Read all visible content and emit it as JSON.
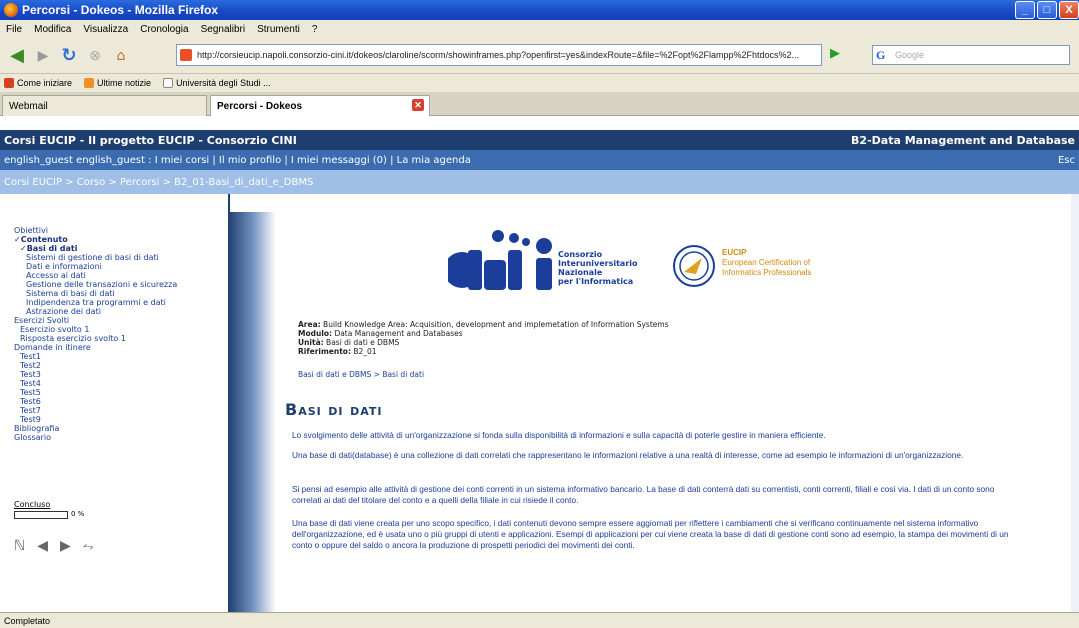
{
  "window": {
    "title": "Percorsi - Dokeos - Mozilla Firefox",
    "buttons": [
      "_",
      "□",
      "X"
    ]
  },
  "menu": [
    "File",
    "Modifica",
    "Visualizza",
    "Cronologia",
    "Segnalibri",
    "Strumenti",
    "?"
  ],
  "nav": {
    "url": "http://corsieucip.napoli.consorzio-cini.it/dokeos/claroline/scorm/showinframes.php?openfirst=yes&indexRoute=&file=%2Fopt%2Flampp%2Fhtdocs%2...",
    "search_placeholder": "Google"
  },
  "bookmarks": [
    "Come iniziare",
    "Ultime notizie",
    "Università degli Studi ..."
  ],
  "tabs": [
    {
      "label": "Webmail",
      "active": false
    },
    {
      "label": "Percorsi - Dokeos",
      "active": true
    }
  ],
  "header": {
    "site_title": "Corsi EUCIP - Il progetto EUCIP - Consorzio CINI",
    "course_title": "B2-Data Management and Database",
    "user_line": "english_guest english_guest : I miei corsi | Il mio profilo | I miei messaggi (0) | La mia agenda",
    "logout": "Esc",
    "breadcrumb": "Corsi EUCIP > Corso > Percorsi > B2_01-Basi_di_dati_e_DBMS"
  },
  "toc": [
    {
      "label": "Obiettivi",
      "level": 0,
      "bold": false
    },
    {
      "label": "✓Contenuto",
      "level": 0,
      "bold": true
    },
    {
      "label": "✓Basi di dati",
      "level": 1,
      "bold": true
    },
    {
      "label": "Sistemi di gestione di basi di dati",
      "level": 2,
      "bold": false
    },
    {
      "label": "Dati e informazioni",
      "level": 2,
      "bold": false
    },
    {
      "label": "Accesso ai dati",
      "level": 2,
      "bold": false
    },
    {
      "label": "Gestione delle transazioni e sicurezza",
      "level": 2,
      "bold": false
    },
    {
      "label": "Sistema di basi di dati",
      "level": 2,
      "bold": false
    },
    {
      "label": "Indipendenza tra programmi e dati",
      "level": 2,
      "bold": false
    },
    {
      "label": "Astrazione dei dati",
      "level": 2,
      "bold": false
    },
    {
      "label": "Esercizi Svolti",
      "level": 0,
      "bold": false
    },
    {
      "label": "Esercizio svolto 1",
      "level": 1,
      "bold": false
    },
    {
      "label": "Risposta esercizio svolto 1",
      "level": 1,
      "bold": false
    },
    {
      "label": "Domande in itinere",
      "level": 0,
      "bold": false
    },
    {
      "label": "Test1",
      "level": 1,
      "bold": false
    },
    {
      "label": "Test2",
      "level": 1,
      "bold": false
    },
    {
      "label": "Test3",
      "level": 1,
      "bold": false
    },
    {
      "label": "Test4",
      "level": 1,
      "bold": false
    },
    {
      "label": "Test5",
      "level": 1,
      "bold": false
    },
    {
      "label": "Test6",
      "level": 1,
      "bold": false
    },
    {
      "label": "Test7",
      "level": 1,
      "bold": false
    },
    {
      "label": "Test9",
      "level": 1,
      "bold": false
    },
    {
      "label": "Bibliografia",
      "level": 0,
      "bold": false
    },
    {
      "label": "Glossario",
      "level": 0,
      "bold": false
    }
  ],
  "progress": {
    "label": "Concluso",
    "value_text": "0 %",
    "value": 0
  },
  "logos": {
    "cini_lines": [
      "Consorzio",
      "Interuniversitario",
      "Nazionale",
      "per l'Informatica"
    ],
    "eucip_lines": [
      "EUCIP",
      "European Certification of",
      "Informatics Professionals"
    ]
  },
  "meta": {
    "area_label": "Area:",
    "area_value": "Build Knowledge Area: Acquisition, development and implemetation of Information Systems",
    "modulo_label": "Modulo:",
    "modulo_value": "Data Management and Databases",
    "unita_label": "Unità:",
    "unita_value": "Basi di dati e DBMS",
    "rif_label": "Riferimento:",
    "rif_value": "B2_01"
  },
  "content_breadcrumb": "Basi di dati e DBMS > Basi di dati",
  "page_title": "Basi di dati",
  "paragraphs": [
    "Lo svolgimento delle attività di un'organizzazione si fonda sulla disponibilità di informazioni e sulla capacità di poterle gestire in maniera efficiente.",
    "Una base di dati(database) è una collezione di dati correlati che rappresentano le informazioni relative a una realtà di interesse, come ad esempio le informazioni di un'organizzazione.",
    "Si pensi ad esempio alle attività di gestione dei conti correnti in un sistema informativo bancario. La base di dati conterrà dati su correntisti, conti correnti, filiali e così via. I dati di un conto sono correlati ai dati del titolare del conto e a quelli della filiale in cui risiede il conto.",
    "Una base di dati viene creata per uno scopo specifico, i dati contenuti devono sempre essere aggiornati per riflettere i cambiamenti che si verificano continuamente nel sistema informativo dell'organizzazione, ed è usata uno o più gruppi di utenti e applicazioni. Esempi di applicazioni per cui viene creata la base di dati di gestione conti sono ad esempio, la stampa dei movimenti di un conto o oppure del saldo o ancora la produzione di prospetti periodici dei movimenti dei conti."
  ],
  "status": "Completato"
}
